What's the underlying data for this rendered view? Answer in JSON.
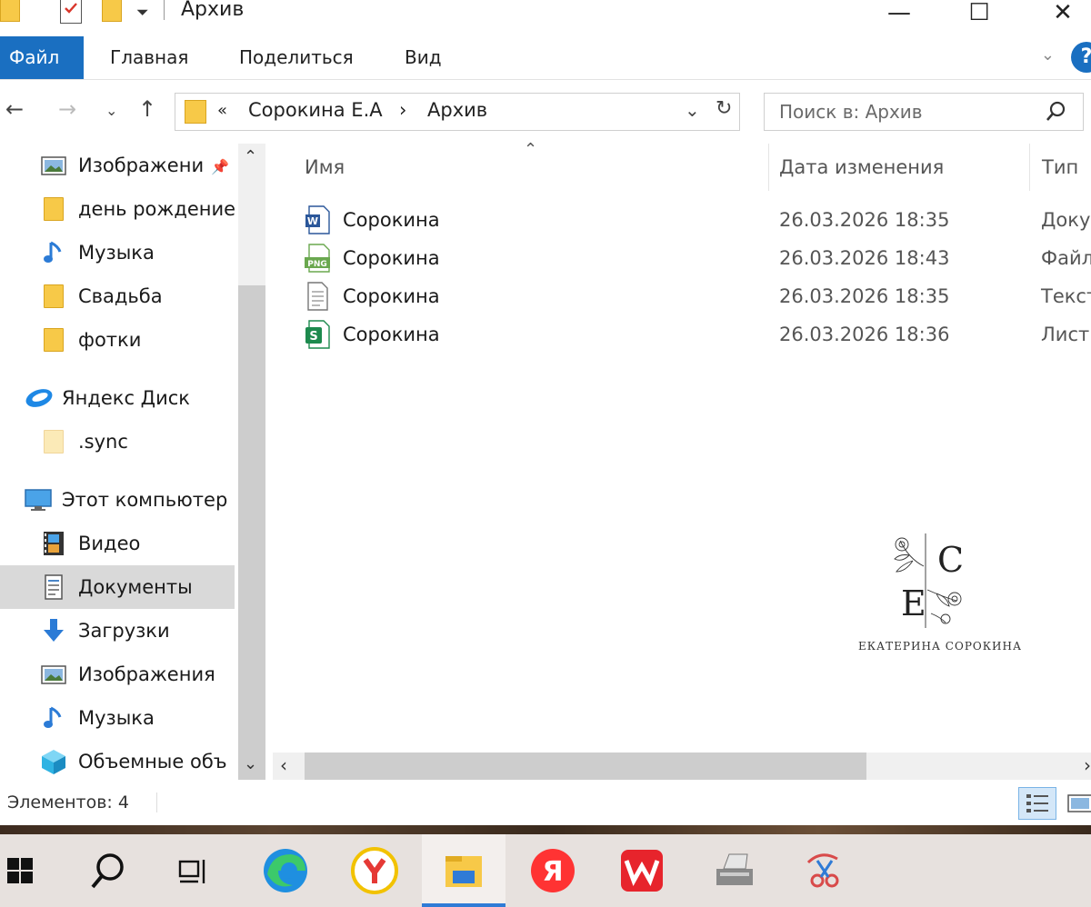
{
  "window": {
    "title": "Архив",
    "minimize_glyph": "—",
    "maximize_glyph": "☐",
    "close_glyph": "✕"
  },
  "ribbon": {
    "tabs": [
      "Файл",
      "Главная",
      "Поделиться",
      "Вид"
    ],
    "active_tab": "Файл",
    "accent": "#1a6fc1"
  },
  "address": {
    "overflow": "«",
    "crumbs": [
      "Сорокина Е.А",
      "Архив"
    ],
    "separator": "›"
  },
  "search": {
    "placeholder": "Поиск в: Архив"
  },
  "navpane": {
    "items": [
      {
        "label": "Изображени",
        "icon": "pictures-icon",
        "pinned": true
      },
      {
        "label": "день рождение",
        "icon": "folder-icon"
      },
      {
        "label": "Музыка",
        "icon": "music-icon"
      },
      {
        "label": "Свадьба",
        "icon": "folder-icon"
      },
      {
        "label": "фотки",
        "icon": "folder-icon"
      },
      {
        "label": "Яндекс Диск",
        "icon": "yandex-disk-icon"
      },
      {
        "label": ".sync",
        "icon": "folder-pale-icon"
      },
      {
        "label": "Этот компьютер",
        "icon": "computer-icon"
      },
      {
        "label": "Видео",
        "icon": "video-icon"
      },
      {
        "label": "Документы",
        "icon": "documents-icon",
        "selected": true
      },
      {
        "label": "Загрузки",
        "icon": "downloads-icon"
      },
      {
        "label": "Изображения",
        "icon": "pictures-icon"
      },
      {
        "label": "Музыка",
        "icon": "music-icon"
      },
      {
        "label": "Объемные объ",
        "icon": "3d-objects-icon"
      }
    ]
  },
  "filelist": {
    "columns": [
      "Имя",
      "Дата изменения",
      "Тип"
    ],
    "rows": [
      {
        "name": "Сорокина",
        "date": "26.03.2026 18:35",
        "type": "Доку",
        "icon": "word-doc-icon"
      },
      {
        "name": "Сорокина",
        "date": "26.03.2026 18:43",
        "type": "Файл",
        "icon": "png-file-icon"
      },
      {
        "name": "Сорокина",
        "date": "26.03.2026 18:35",
        "type": "Текст",
        "icon": "text-file-icon"
      },
      {
        "name": "Сорокина",
        "date": "26.03.2026 18:36",
        "type": "Лист",
        "icon": "spreadsheet-icon"
      }
    ]
  },
  "logo": {
    "initial_top": "C",
    "initial_bottom": "E",
    "caption": "ЕКАТЕРИНА СОРОКИНА"
  },
  "status": {
    "items_count": "Элементов: 4"
  },
  "taskbar": {
    "items": [
      "start-icon",
      "search-icon",
      "task-view-icon",
      "edge-icon",
      "yandex-browser-icon",
      "file-explorer-icon",
      "yandex-icon",
      "wps-office-icon",
      "scanner-icon",
      "snipping-tool-icon"
    ],
    "active": "file-explorer-icon"
  }
}
